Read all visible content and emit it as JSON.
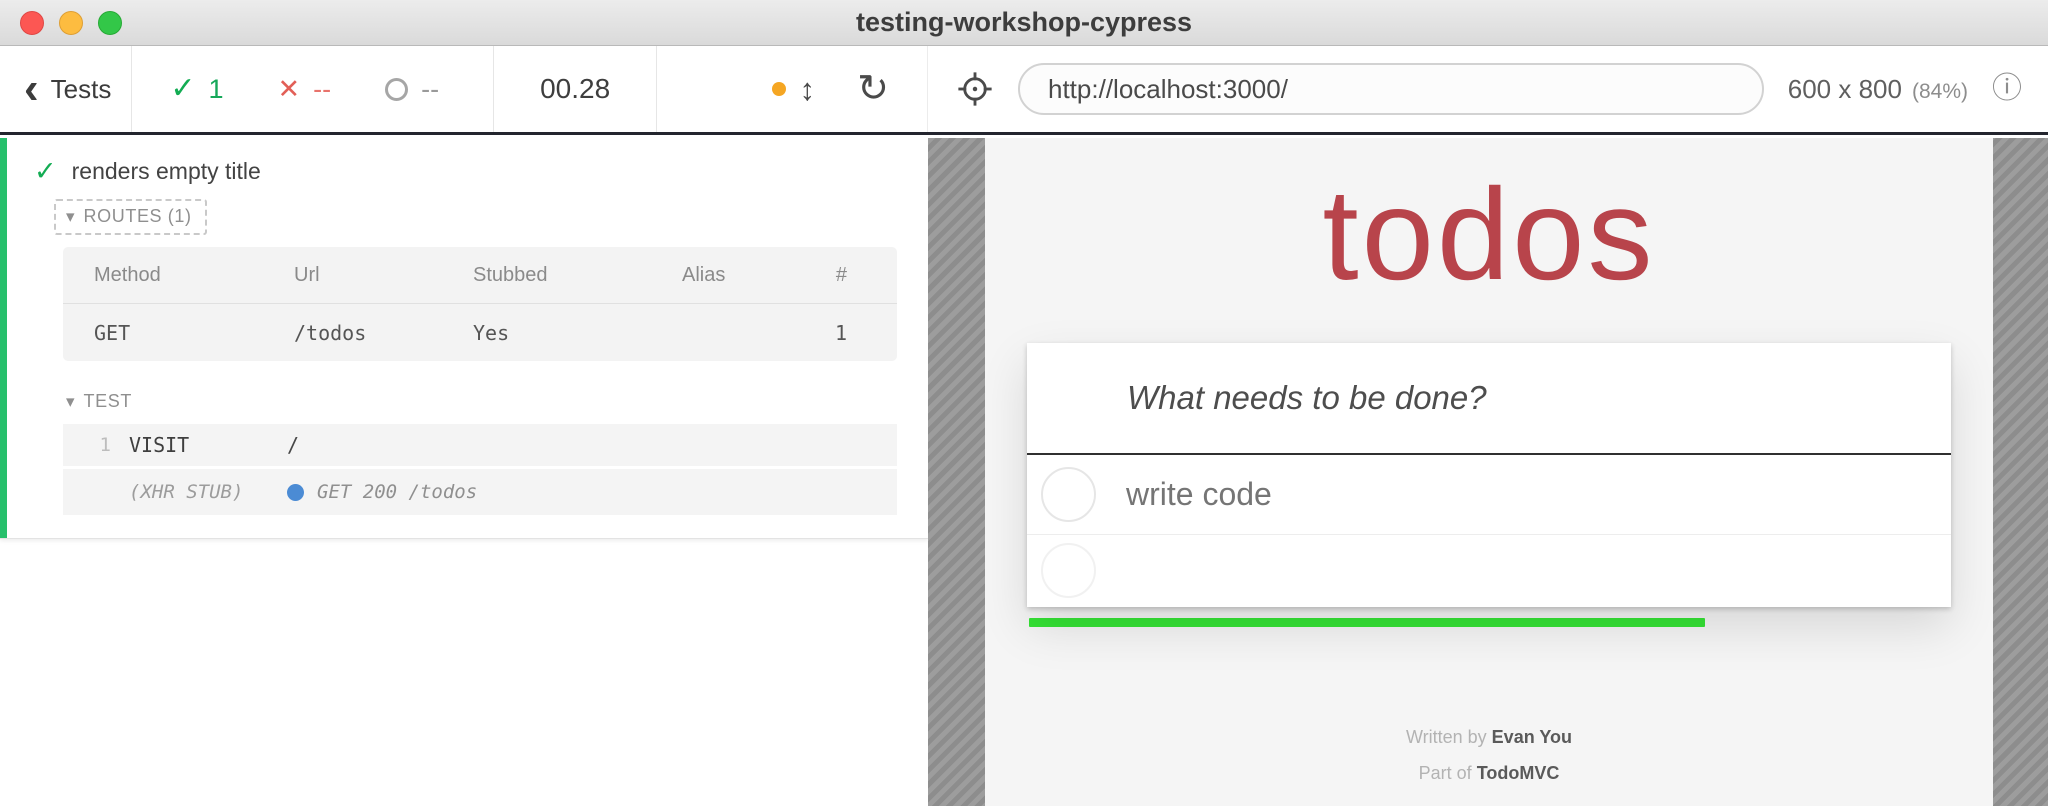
{
  "window": {
    "title": "testing-workshop-cypress"
  },
  "icons": {
    "chevron_left": "‹",
    "check": "✓",
    "cross": "✕",
    "caret_down": "▾",
    "viewport_arrows": "↕",
    "refresh": "↻",
    "info": "ⓘ"
  },
  "toolbar": {
    "back_label": "Tests",
    "stats": {
      "passed": "1",
      "failed": "--",
      "pending": "--"
    },
    "duration": "00.28",
    "url": "http://localhost:3000/",
    "viewport_size": "600 x 800",
    "viewport_scale": "(84%)"
  },
  "reporter": {
    "test": {
      "title": "renders empty title",
      "routes": {
        "header": "ROUTES (1)",
        "columns": {
          "method": "Method",
          "url": "Url",
          "stubbed": "Stubbed",
          "alias": "Alias",
          "count": "#"
        },
        "rows": [
          {
            "method": "GET",
            "url": "/todos",
            "stubbed": "Yes",
            "alias": "",
            "count": "1"
          }
        ]
      },
      "commands": {
        "header": "TEST",
        "items": [
          {
            "number": "1",
            "name": "VISIT",
            "message": "/"
          },
          {
            "number": "",
            "name": "(XHR STUB)",
            "message": "GET 200 /todos"
          }
        ]
      }
    }
  },
  "aut": {
    "app_title": "todos",
    "new_todo_placeholder": "What needs to be done?",
    "todos": [
      {
        "label": "write code"
      },
      {
        "label": ""
      }
    ],
    "footer_line1": {
      "prefix": "Written by",
      "value": "Evan You"
    },
    "footer_line2": {
      "prefix": "Part of",
      "value": "TodoMVC"
    }
  },
  "colors": {
    "pass_green": "#13ac53",
    "fail_red": "#e25f57",
    "pending_gray": "#9a9a9a",
    "brand_red": "#b8444b",
    "progress_green": "#35e335",
    "orange_dot": "#f5a623",
    "xhr_dot_blue": "#4b8bd4"
  }
}
